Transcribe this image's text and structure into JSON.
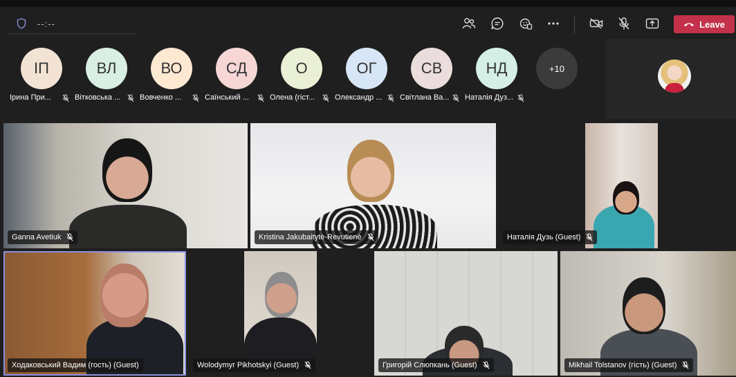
{
  "toolbar": {
    "timer": "--:--",
    "leave_label": "Leave",
    "icons": [
      "shield-icon",
      "people-icon",
      "chat-icon",
      "react-icon",
      "more-icon",
      "camera-off-icon",
      "mic-off-icon",
      "share-icon",
      "phone-icon"
    ]
  },
  "roster": {
    "participants": [
      {
        "initials": "ІП",
        "name": "Ірина При...",
        "color": "#f3e3d5"
      },
      {
        "initials": "ВЛ",
        "name": "Вітковська ...",
        "color": "#d9efe3"
      },
      {
        "initials": "ВО",
        "name": "Вовченко ...",
        "color": "#fde8d2"
      },
      {
        "initials": "СД",
        "name": "Саїнський ...",
        "color": "#f6d7d6"
      },
      {
        "initials": "О",
        "name": "Олена (гіст...",
        "color": "#eaf0d5"
      },
      {
        "initials": "ОГ",
        "name": "Олександр ...",
        "color": "#d7e6f6"
      },
      {
        "initials": "СВ",
        "name": "Світлана Ва...",
        "color": "#ecdddd"
      },
      {
        "initials": "НД",
        "name": "Наталія Дуз...",
        "color": "#d5efe6"
      }
    ],
    "overflow_label": "+10"
  },
  "tiles": [
    {
      "name": "Ganna Avetiuk"
    },
    {
      "name": "Kristina Jakubaitytė-Revutienė"
    },
    {
      "name": "Наталія Дузь (Guest)"
    },
    {
      "name": "Ходаковський Вадим (гость) (Guest)"
    },
    {
      "name": "Wolodymyr Pikhotskyi (Guest)"
    },
    {
      "name": "Григорій Слюпкань (Guest)"
    },
    {
      "name": "Mikhail Tolstanov (гість) (Guest)"
    }
  ]
}
